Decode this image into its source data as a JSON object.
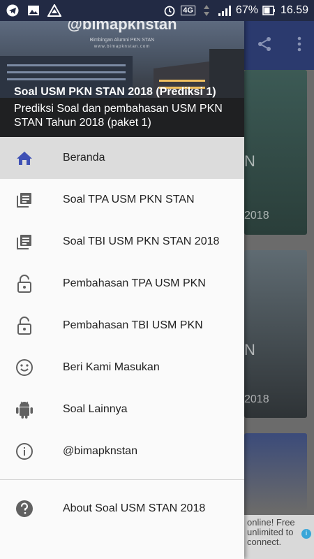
{
  "status": {
    "lte": "4G",
    "battery": "67%",
    "time": "16.59"
  },
  "header": {
    "watermark": "@bimapknstan",
    "watermark_sub": "Bimbingan Alumni PKN STAN",
    "watermark_url": "www.bimapknstan.com",
    "title": "Soal USM PKN STAN 2018 (Prediksi 1)",
    "description": "Prediksi Soal dan pembahasan USM PKN STAN Tahun 2018 (paket 1)"
  },
  "menu": {
    "items": [
      {
        "label": "Beranda",
        "icon": "home-icon"
      },
      {
        "label": "Soal TPA USM PKN STAN",
        "icon": "book-icon"
      },
      {
        "label": "Soal TBI USM PKN STAN 2018",
        "icon": "book-icon"
      },
      {
        "label": "Pembahasan TPA USM PKN",
        "icon": "lock-open-icon"
      },
      {
        "label": "Pembahasan TBI USM PKN",
        "icon": "lock-open-icon"
      },
      {
        "label": "Beri Kami Masukan",
        "icon": "smiley-icon"
      },
      {
        "label": "Soal Lainnya",
        "icon": "android-icon"
      },
      {
        "label": "@bimapknstan",
        "icon": "info-icon"
      }
    ],
    "about": {
      "label": "About Soal USM STAN 2018",
      "icon": "help-icon"
    }
  },
  "background": {
    "card_texts": [
      "N",
      "2018",
      "N",
      "2018"
    ],
    "ad_text": "online! Free unlimited to connect."
  },
  "colors": {
    "accent": "#3f51b5",
    "icon_gray": "#616161",
    "toolbar": "#2b3a6e"
  }
}
